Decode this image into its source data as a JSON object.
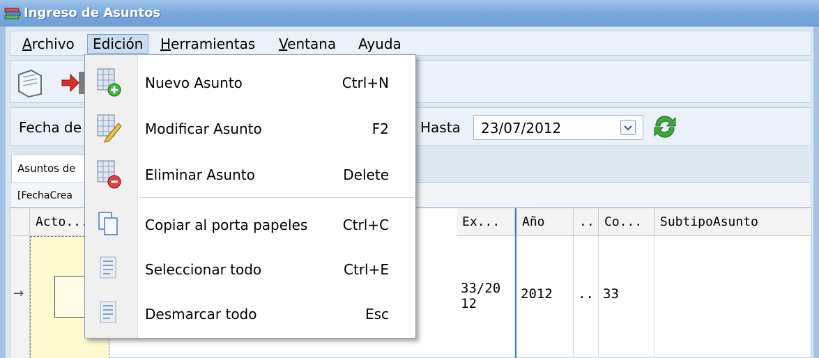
{
  "window": {
    "title": "Ingreso de Asuntos"
  },
  "menubar": {
    "items": [
      {
        "label": "Archivo"
      },
      {
        "label": "Edición"
      },
      {
        "label": "Herramientas"
      },
      {
        "label": "Ventana"
      },
      {
        "label": "Ayuda"
      }
    ]
  },
  "filter": {
    "from_label": "Fecha de",
    "to_label": "Hasta",
    "to_date": "23/07/2012"
  },
  "tabs": [
    {
      "label": "Asuntos de"
    }
  ],
  "group": {
    "label": "[FechaCrea"
  },
  "grid": {
    "columns": [
      "Acto...",
      "Ex...",
      "Año",
      "..",
      "Co...",
      "SubtipoAsunto"
    ],
    "row": {
      "ex": "33/20",
      "ex2": "12",
      "anio": "2012",
      "dots": "..",
      "co": "33"
    }
  },
  "dropdown": {
    "items": [
      {
        "label": "Nuevo Asunto",
        "shortcut": "Ctrl+N",
        "icon": "grid-add-icon"
      },
      {
        "label": "Modificar Asunto",
        "shortcut": "F2",
        "icon": "grid-edit-icon"
      },
      {
        "label": "Eliminar Asunto",
        "shortcut": "Delete",
        "icon": "grid-delete-icon"
      },
      {
        "label": "Copiar al porta papeles",
        "shortcut": "Ctrl+C",
        "icon": "copy-icon"
      },
      {
        "label": "Seleccionar todo",
        "shortcut": "Ctrl+E",
        "icon": "document-lines-icon"
      },
      {
        "label": "Desmarcar todo",
        "shortcut": "Esc",
        "icon": "document-lines-icon"
      }
    ]
  }
}
